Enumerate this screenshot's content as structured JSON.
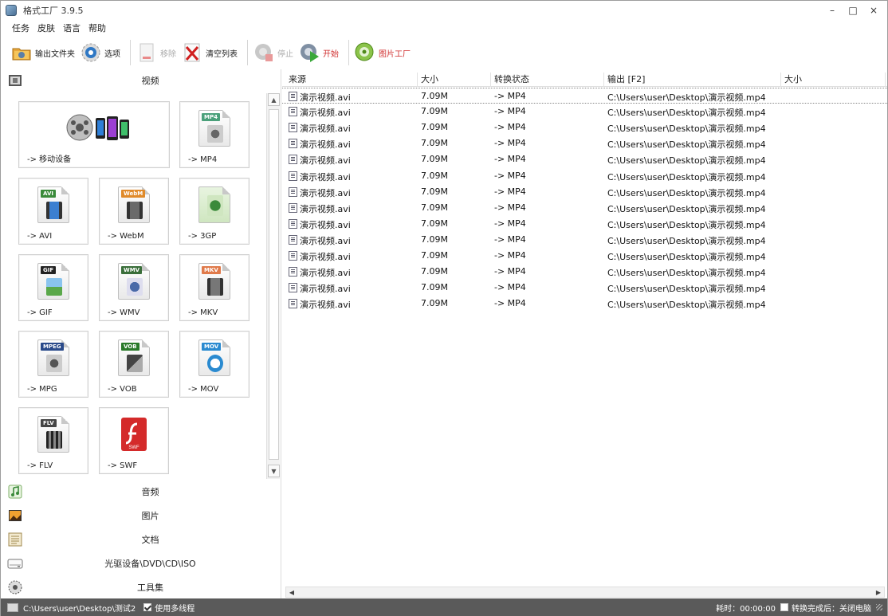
{
  "window": {
    "title": "格式工厂 3.9.5",
    "controls": [
      "–",
      "□",
      "×"
    ]
  },
  "menu": [
    "任务",
    "皮肤",
    "语言",
    "帮助"
  ],
  "toolbar": {
    "output_folder": "输出文件夹",
    "options": "选项",
    "remove": "移除",
    "clear_list": "清空列表",
    "stop": "停止",
    "start": "开始",
    "picture_factory": "图片工厂"
  },
  "left": {
    "video_category": "视频",
    "tiles": [
      {
        "label": "-> 移动设备",
        "tag": ""
      },
      {
        "label": "-> MP4",
        "tag": "MP4"
      },
      {
        "label": "-> AVI",
        "tag": "AVI"
      },
      {
        "label": "-> WebM",
        "tag": "WebM"
      },
      {
        "label": "-> 3GP",
        "tag": "3GP"
      },
      {
        "label": "-> GIF",
        "tag": "GIF"
      },
      {
        "label": "-> WMV",
        "tag": "WMV"
      },
      {
        "label": "-> MKV",
        "tag": "MKV"
      },
      {
        "label": "-> MPG",
        "tag": "MPEG"
      },
      {
        "label": "-> VOB",
        "tag": "VOB"
      },
      {
        "label": "-> MOV",
        "tag": "MOV"
      },
      {
        "label": "-> FLV",
        "tag": "FLV"
      },
      {
        "label": "-> SWF",
        "tag": "SWF"
      }
    ],
    "categories": [
      "音频",
      "图片",
      "文档",
      "光驱设备\\DVD\\CD\\ISO",
      "工具集"
    ]
  },
  "list": {
    "columns": [
      "来源",
      "大小",
      "转换状态",
      "输出 [F2]",
      "大小"
    ],
    "rows": [
      {
        "source": "演示视频.avi",
        "size": "7.09M",
        "status": "-> MP4",
        "output": "C:\\Users\\user\\Desktop\\演示视频.mp4"
      },
      {
        "source": "演示视频.avi",
        "size": "7.09M",
        "status": "-> MP4",
        "output": "C:\\Users\\user\\Desktop\\演示视频.mp4"
      },
      {
        "source": "演示视频.avi",
        "size": "7.09M",
        "status": "-> MP4",
        "output": "C:\\Users\\user\\Desktop\\演示视频.mp4"
      },
      {
        "source": "演示视频.avi",
        "size": "7.09M",
        "status": "-> MP4",
        "output": "C:\\Users\\user\\Desktop\\演示视频.mp4"
      },
      {
        "source": "演示视频.avi",
        "size": "7.09M",
        "status": "-> MP4",
        "output": "C:\\Users\\user\\Desktop\\演示视频.mp4"
      },
      {
        "source": "演示视频.avi",
        "size": "7.09M",
        "status": "-> MP4",
        "output": "C:\\Users\\user\\Desktop\\演示视频.mp4"
      },
      {
        "source": "演示视频.avi",
        "size": "7.09M",
        "status": "-> MP4",
        "output": "C:\\Users\\user\\Desktop\\演示视频.mp4"
      },
      {
        "source": "演示视频.avi",
        "size": "7.09M",
        "status": "-> MP4",
        "output": "C:\\Users\\user\\Desktop\\演示视频.mp4"
      },
      {
        "source": "演示视频.avi",
        "size": "7.09M",
        "status": "-> MP4",
        "output": "C:\\Users\\user\\Desktop\\演示视频.mp4"
      },
      {
        "source": "演示视频.avi",
        "size": "7.09M",
        "status": "-> MP4",
        "output": "C:\\Users\\user\\Desktop\\演示视频.mp4"
      },
      {
        "source": "演示视频.avi",
        "size": "7.09M",
        "status": "-> MP4",
        "output": "C:\\Users\\user\\Desktop\\演示视频.mp4"
      },
      {
        "source": "演示视频.avi",
        "size": "7.09M",
        "status": "-> MP4",
        "output": "C:\\Users\\user\\Desktop\\演示视频.mp4"
      },
      {
        "source": "演示视频.avi",
        "size": "7.09M",
        "status": "-> MP4",
        "output": "C:\\Users\\user\\Desktop\\演示视频.mp4"
      },
      {
        "source": "演示视频.avi",
        "size": "7.09M",
        "status": "-> MP4",
        "output": "C:\\Users\\user\\Desktop\\演示视频.mp4"
      }
    ]
  },
  "status": {
    "output_path": "C:\\Users\\user\\Desktop\\测试2",
    "multithread_label": "使用多线程",
    "multithread_checked": true,
    "elapsed": "耗时：00:00:00",
    "after_done": "转换完成后：关闭电脑",
    "after_done_checked": false
  },
  "colors": {
    "statusbar": "#5a5a5a",
    "start_label": "#d03030",
    "picture_factory_label": "#d03030"
  }
}
